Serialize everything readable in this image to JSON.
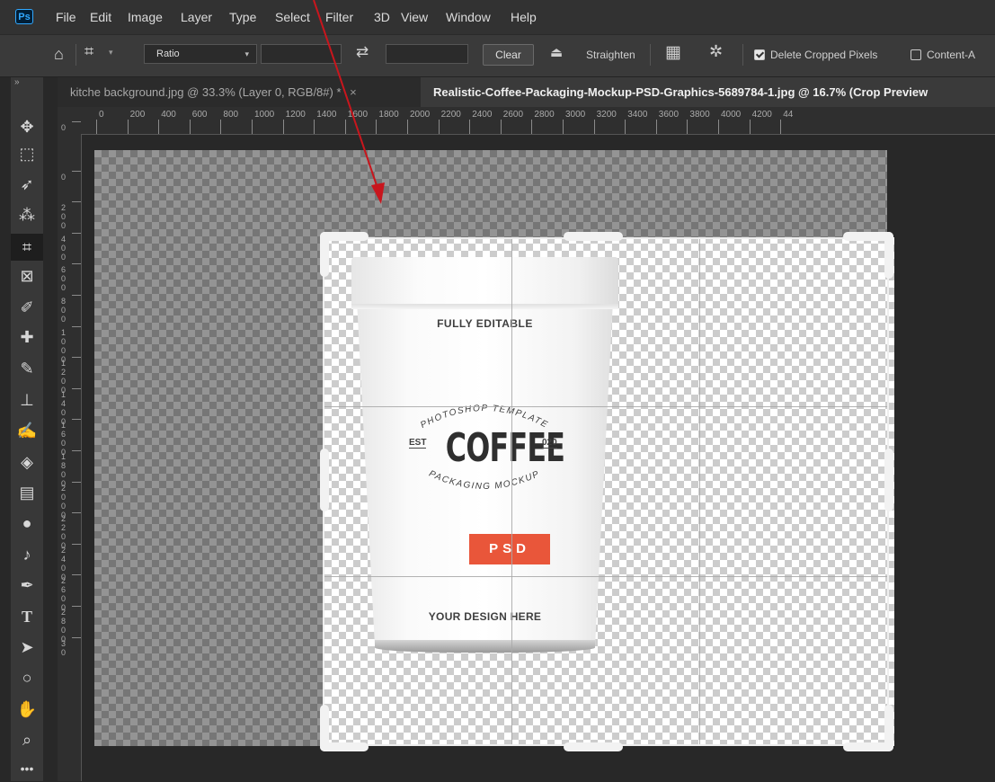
{
  "menu": {
    "logo": "Ps",
    "items": [
      "File",
      "Edit",
      "Image",
      "Layer",
      "Type",
      "Select",
      "Filter",
      "3D",
      "View",
      "Window",
      "Help"
    ]
  },
  "options": {
    "ratio_label": "Ratio",
    "clear_label": "Clear",
    "straighten_label": "Straighten",
    "delete_cropped_label": "Delete Cropped Pixels",
    "delete_cropped_checked": true,
    "content_aware_label": "Content-A",
    "content_aware_checked": false
  },
  "tabs": [
    {
      "label": "kitche background.jpg @ 33.3% (Layer 0, RGB/8#) *",
      "active": false,
      "close": "×"
    },
    {
      "label": "Realistic-Coffee-Packaging-Mockup-PSD-Graphics-5689784-1.jpg @ 16.7% (Crop Preview",
      "active": true
    }
  ],
  "panel_collapse": "»",
  "ruler": {
    "h_ticks": [
      "0",
      "200",
      "400",
      "600",
      "800",
      "1000",
      "1200",
      "1400",
      "1600",
      "1800",
      "2000",
      "2200",
      "2400",
      "2600",
      "2800",
      "3000",
      "3200",
      "3400",
      "3600",
      "3800",
      "4000",
      "4200",
      "44"
    ],
    "v_ticks": [
      "0",
      "0",
      "2 0 0",
      "4 0 0",
      "6 0 0",
      "8 0 0",
      "1 0 0 0",
      "1 2 0 0",
      "1 4 0 0",
      "1 6 0 0",
      "1 8 0 0",
      "2 0 0 0",
      "2 2 0 0",
      "2 4 0 0",
      "2 6 0 0",
      "2 8 0 0",
      "3 0"
    ]
  },
  "bag": {
    "line1": "FULLY EDITABLE",
    "arc_top": "PHOTOSHOP TEMPLATE",
    "est": "EST",
    "coffee": "COFFEE",
    "year": "020",
    "arc_bottom": "PACKAGING MOCKUP",
    "psd": "PSD",
    "bottom": "YOUR DESIGN HERE"
  },
  "colors": {
    "accent_psd": "#e9563a",
    "arrow": "#c8161d",
    "ps_blue": "#31a8ff"
  }
}
